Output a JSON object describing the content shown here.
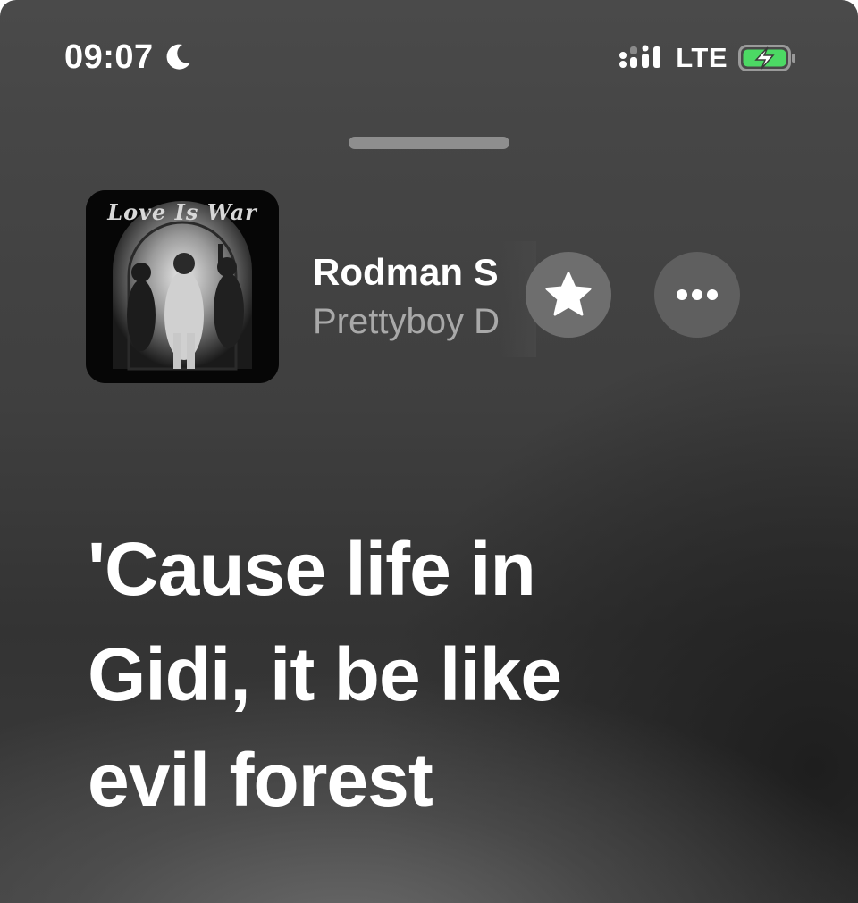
{
  "status_bar": {
    "time": "09:07",
    "focus_icon": "moon-icon",
    "network": "LTE",
    "signal_icon": "cellular-signal-icon",
    "battery_icon": "battery-charging-icon",
    "battery_color": "#4cd964"
  },
  "now_playing": {
    "artwork_text": "Love Is War",
    "title": "Rodman S",
    "artist": "Prettyboy D",
    "favorite_icon": "star-icon",
    "more_icon": "ellipsis-icon"
  },
  "lyrics": {
    "lines": [
      "'Cause life in",
      "Gidi, it be like",
      "evil forest"
    ]
  }
}
